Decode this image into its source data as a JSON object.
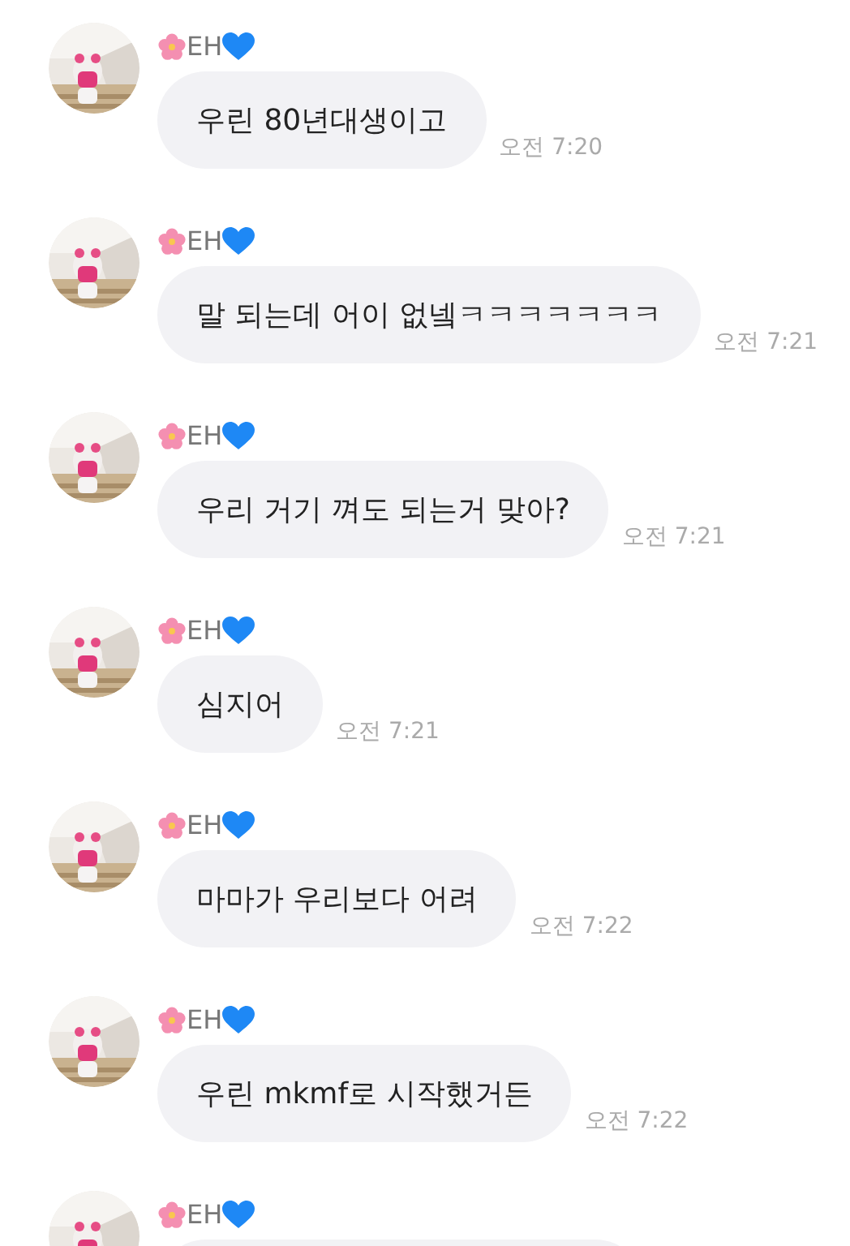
{
  "messages": [
    {
      "sender": "EH",
      "text": "우린 80년대생이고",
      "time": "오전 7:20"
    },
    {
      "sender": "EH",
      "text": "말 되는데 어이 없넼ㅋㅋㅋㅋㅋㅋㅋ",
      "time": "오전 7:21"
    },
    {
      "sender": "EH",
      "text": "우리 거기 껴도 되는거 맞아?",
      "time": "오전 7:21"
    },
    {
      "sender": "EH",
      "text": "심지어",
      "time": "오전 7:21"
    },
    {
      "sender": "EH",
      "text": "마마가 우리보다 어려",
      "time": "오전 7:22"
    },
    {
      "sender": "EH",
      "text": "우린 mkmf로 시작했거든",
      "time": "오전 7:22"
    },
    {
      "sender": "EH"
    }
  ]
}
